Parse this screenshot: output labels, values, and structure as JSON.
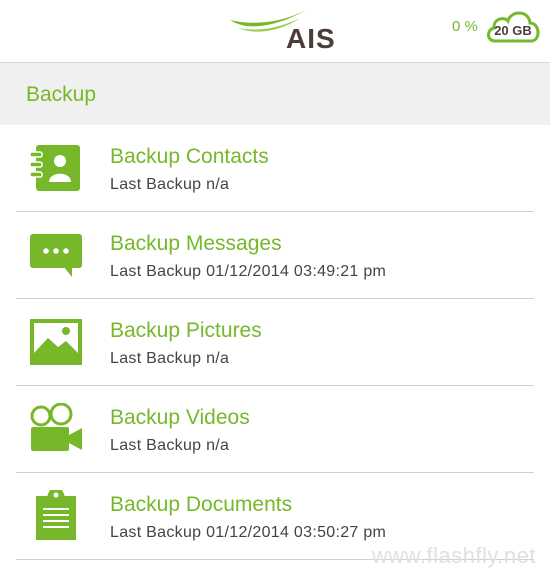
{
  "header": {
    "logo_text": "AIS",
    "storage_percent": "0 %",
    "storage_capacity": "20 GB"
  },
  "section": {
    "title": "Backup"
  },
  "items": [
    {
      "title": "Backup Contacts",
      "subtitle": "Last Backup n/a",
      "icon": "contacts-icon"
    },
    {
      "title": "Backup Messages",
      "subtitle": "Last Backup 01/12/2014 03:49:21 pm",
      "icon": "messages-icon"
    },
    {
      "title": "Backup Pictures",
      "subtitle": "Last Backup n/a",
      "icon": "pictures-icon"
    },
    {
      "title": "Backup Videos",
      "subtitle": "Last Backup n/a",
      "icon": "videos-icon"
    },
    {
      "title": "Backup Documents",
      "subtitle": "Last Backup 01/12/2014 03:50:27 pm",
      "icon": "documents-icon"
    }
  ],
  "watermark": "www.flashfly.net",
  "colors": {
    "accent": "#76b82a",
    "brand_dark": "#4a3d3a",
    "section_bg": "#f0f0f0"
  }
}
